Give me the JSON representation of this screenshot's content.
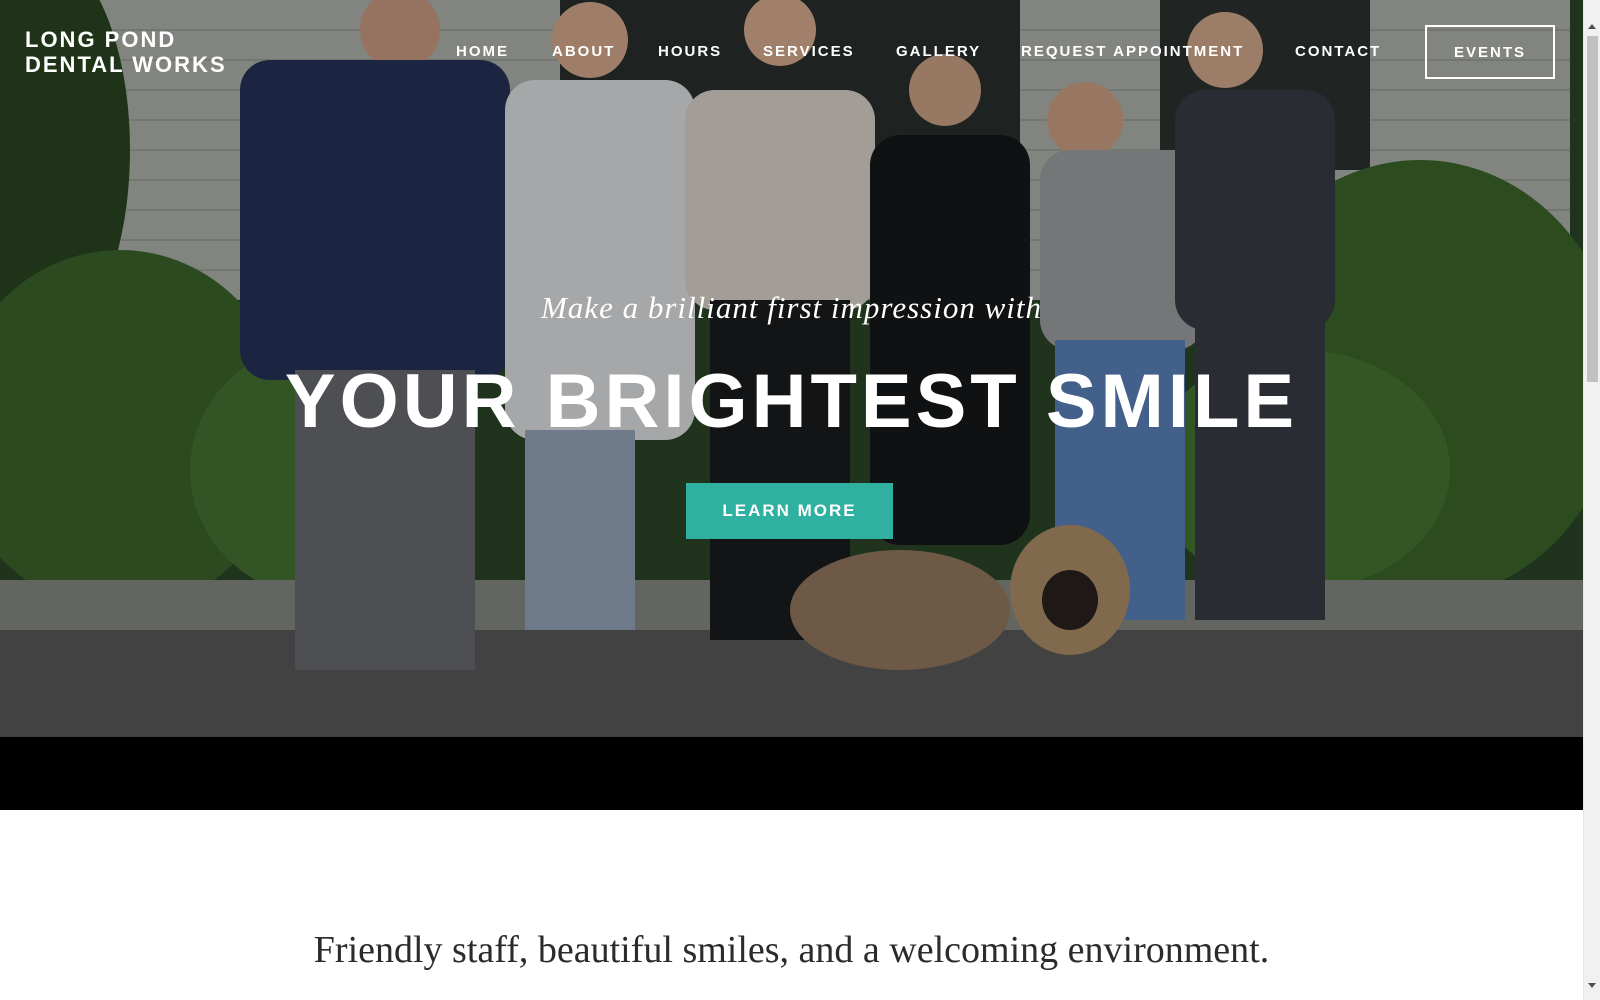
{
  "site": {
    "title_line1": "LONG POND",
    "title_line2": "DENTAL WORKS"
  },
  "nav": {
    "items": [
      {
        "label": "HOME"
      },
      {
        "label": "ABOUT"
      },
      {
        "label": "HOURS"
      },
      {
        "label": "SERVICES"
      },
      {
        "label": "GALLERY"
      },
      {
        "label": "REQUEST APPOINTMENT"
      },
      {
        "label": "CONTACT"
      }
    ],
    "events_label": "EVENTS"
  },
  "hero": {
    "tagline": "Make a brilliant first impression with",
    "headline": "YOUR BRIGHTEST SMILE",
    "button_label": "LEARN MORE",
    "button_color": "#30b0a0",
    "image_description": "dental-team-group-photo"
  },
  "intro": {
    "text": "Friendly staff, beautiful smiles, and a welcoming environment."
  },
  "colors": {
    "accent": "#30b0a0",
    "band": "#000000",
    "text_dark": "#2b2b2b"
  }
}
